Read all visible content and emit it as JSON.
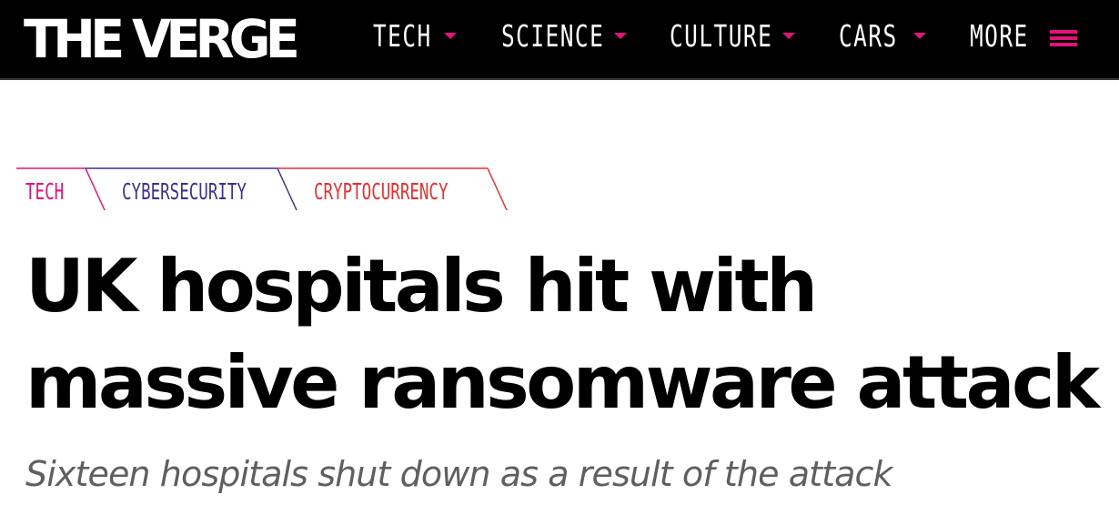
{
  "header": {
    "logo_text": "THE VERGE",
    "nav": [
      {
        "label": "TECH"
      },
      {
        "label": "SCIENCE"
      },
      {
        "label": "CULTURE"
      },
      {
        "label": "CARS"
      },
      {
        "label": "MORE"
      }
    ],
    "menu_icon": "hamburger-icon",
    "accent_color": "#e2127a"
  },
  "tags": [
    {
      "label": "TECH",
      "color": "#e2127a"
    },
    {
      "label": "CYBERSECURITY",
      "color": "#3b3192"
    },
    {
      "label": "CRYPTOCURRENCY",
      "color": "#e4312f"
    }
  ],
  "article": {
    "headline": "UK hospitals hit with massive ransomware attack",
    "dek": "Sixteen hospitals shut down as a result of the attack"
  }
}
